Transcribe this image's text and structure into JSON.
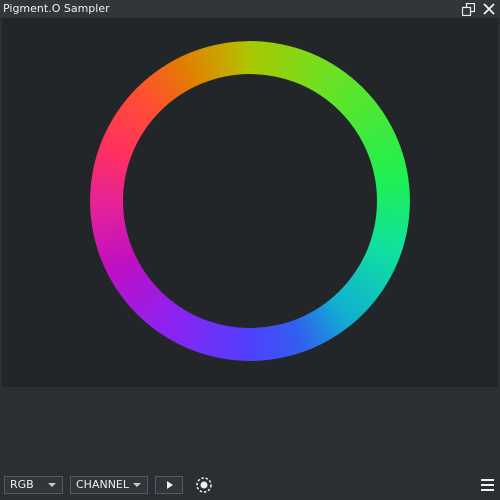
{
  "window": {
    "title": "Pigment.O Sampler",
    "float_icon": "float-window-icon",
    "close_icon": "close-icon"
  },
  "sampler": {
    "wheel_type": "hue-ring",
    "background_color": "#232629"
  },
  "toolbar": {
    "color_model": "RGB",
    "mode": "CHANNEL",
    "play_icon": "play-icon",
    "sampler_icon": "sampler-target-icon",
    "menu_icon": "hamburger-menu-icon"
  }
}
